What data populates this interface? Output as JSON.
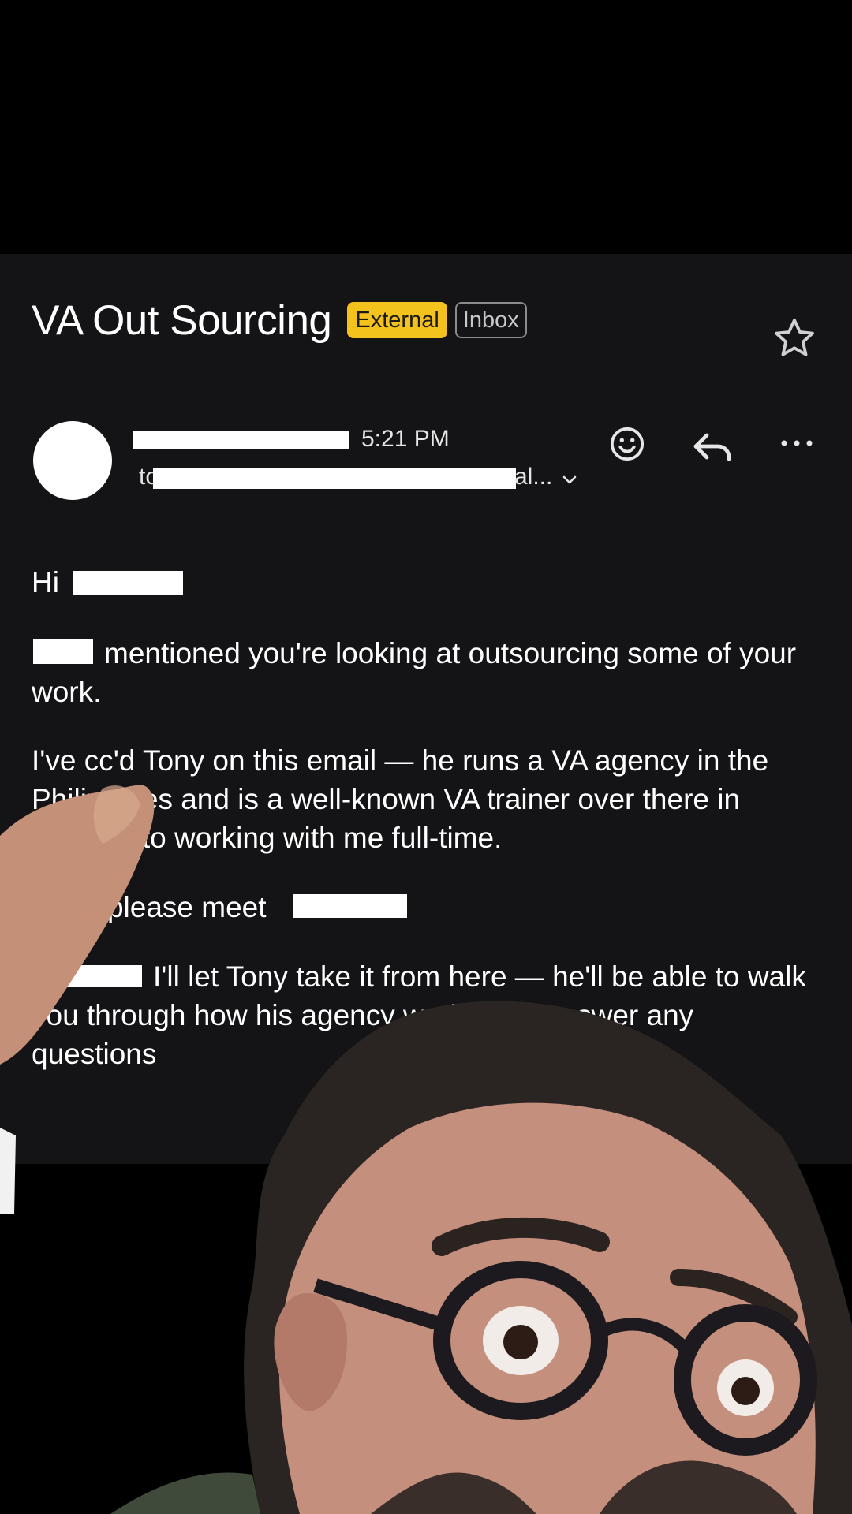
{
  "email": {
    "subject": "VA Out Sourcing",
    "badges": {
      "external": "External",
      "inbox": "Inbox"
    },
    "time": "5:21 PM",
    "to_prefix": "to",
    "to_suffix": "al...",
    "icons": {
      "star": "star-icon",
      "chevron": "chevron-down-icon",
      "emoji": "emoji-icon",
      "reply": "reply-icon",
      "more": "more-icon"
    },
    "colors": {
      "background": "#141416",
      "external_badge": "#f4c21d",
      "text": "#ffffff"
    },
    "body": {
      "greeting": "Hi",
      "p1": "mentioned you're looking at outsourcing some of your work.",
      "p2": "I've cc'd Tony on this email — he runs a VA agency in the Philippines and is a well-known VA trainer over there in addition to working with me full-time.",
      "p3": "Tony, please meet",
      "p4": "I'll let Tony take it from here — he'll be able to walk you through how his agency works and answer any questions"
    }
  }
}
